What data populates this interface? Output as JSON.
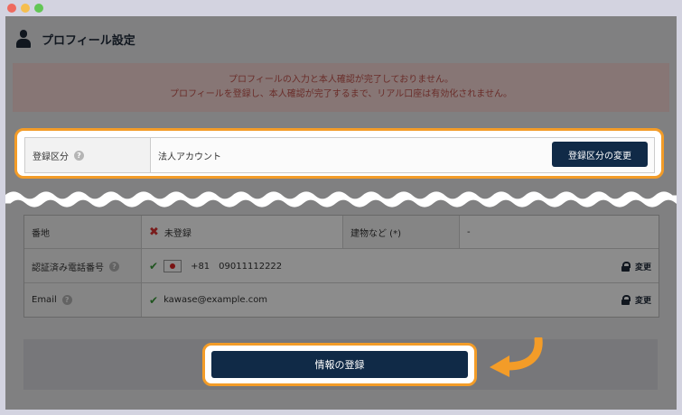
{
  "window": {
    "controls": [
      "close",
      "minimize",
      "maximize"
    ]
  },
  "header": {
    "title": "プロフィール設定",
    "icon": "user-icon"
  },
  "alert": {
    "line1": "プロフィールの入力と本人確認が完了しておりません。",
    "line2": "プロフィールを登録し、本人確認が完了するまで、リアル口座は有効化されません。"
  },
  "category": {
    "label": "登録区分",
    "value": "法人アカウント",
    "button": "登録区分の変更"
  },
  "table": {
    "address_row": {
      "label": "番地",
      "status": "未登録",
      "building_label": "建物など (*)",
      "building_value": "-"
    },
    "phone_row": {
      "label": "認証済み電話番号",
      "country_code": "+81",
      "number": "09011112222",
      "action": "変更"
    },
    "email_row": {
      "label": "Email",
      "value": "kawase@example.com",
      "action": "変更"
    }
  },
  "footer": {
    "register_button": "情報の登録"
  },
  "colors": {
    "highlight": "#f39c28",
    "button": "#102a47",
    "alert_bg": "#f6d7d5",
    "alert_text": "#c0524c"
  }
}
